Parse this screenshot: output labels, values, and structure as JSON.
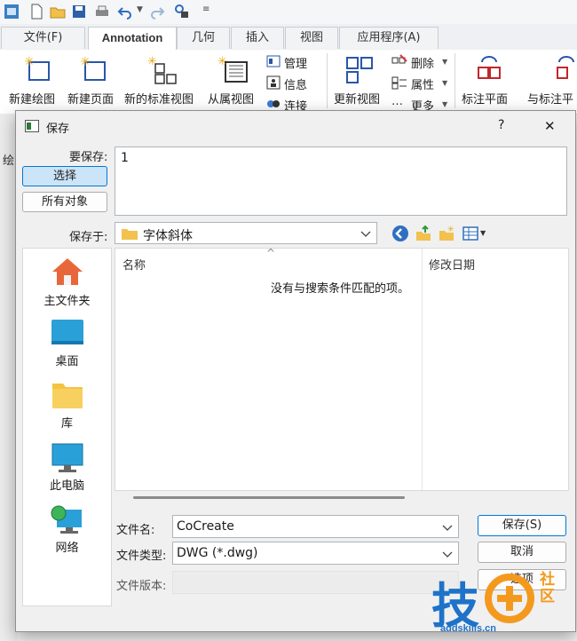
{
  "quick_access": {
    "icons": [
      "app-icon",
      "new-file-icon",
      "open-folder-icon",
      "save-icon",
      "print-icon",
      "undo-icon",
      "dropdown-icon",
      "redo-icon",
      "tools-icon",
      "customize-icon"
    ]
  },
  "tabs": [
    {
      "label": "文件(F)"
    },
    {
      "label": "Annotation"
    },
    {
      "label": "几何"
    },
    {
      "label": "插入"
    },
    {
      "label": "视图"
    },
    {
      "label": "应用程序(A)"
    }
  ],
  "ribbon": {
    "new_drawing": "新建绘图",
    "new_page": "新建页面",
    "new_std_view": "新的标准视图",
    "sub_view": "从属视图",
    "manage": "管理",
    "info": "信息",
    "link": "连接",
    "update_view": "更新视图",
    "delete": "删除",
    "property": "属性",
    "more": "更多",
    "anno_plane": "标注平面",
    "with_anno": "与标注平",
    "strip_label": "绘"
  },
  "dialog": {
    "title": "保存",
    "help": "?",
    "close": "✕",
    "to_save_label": "要保存:",
    "select_button": "选择",
    "all_objects_button": "所有对象",
    "to_save_value": "1",
    "save_in_label": "保存于:",
    "save_in_value": "字体斜体",
    "places": [
      {
        "label": "主文件夹",
        "icon": "home-icon"
      },
      {
        "label": "桌面",
        "icon": "desktop-icon"
      },
      {
        "label": "库",
        "icon": "library-folder-icon"
      },
      {
        "label": "此电脑",
        "icon": "computer-icon"
      },
      {
        "label": "网络",
        "icon": "network-icon"
      }
    ],
    "columns": {
      "name": "名称",
      "date": "修改日期"
    },
    "empty_message": "没有与搜索条件匹配的项。",
    "filename_label": "文件名:",
    "filename_value": "CoCreate",
    "filetype_label": "文件类型:",
    "filetype_value": "DWG (*.dwg)",
    "version_label": "文件版本:",
    "save_button": "保存(S)",
    "cancel_button": "取消",
    "options_button": "选项"
  },
  "watermark": {
    "text": "技",
    "sub": "社区",
    "url": "addskills.cn"
  },
  "colors": {
    "accent": "#0078d4",
    "select_bg": "#cce4f7",
    "watermark_blue": "#1e73c8",
    "watermark_orange": "#f39a1e"
  }
}
